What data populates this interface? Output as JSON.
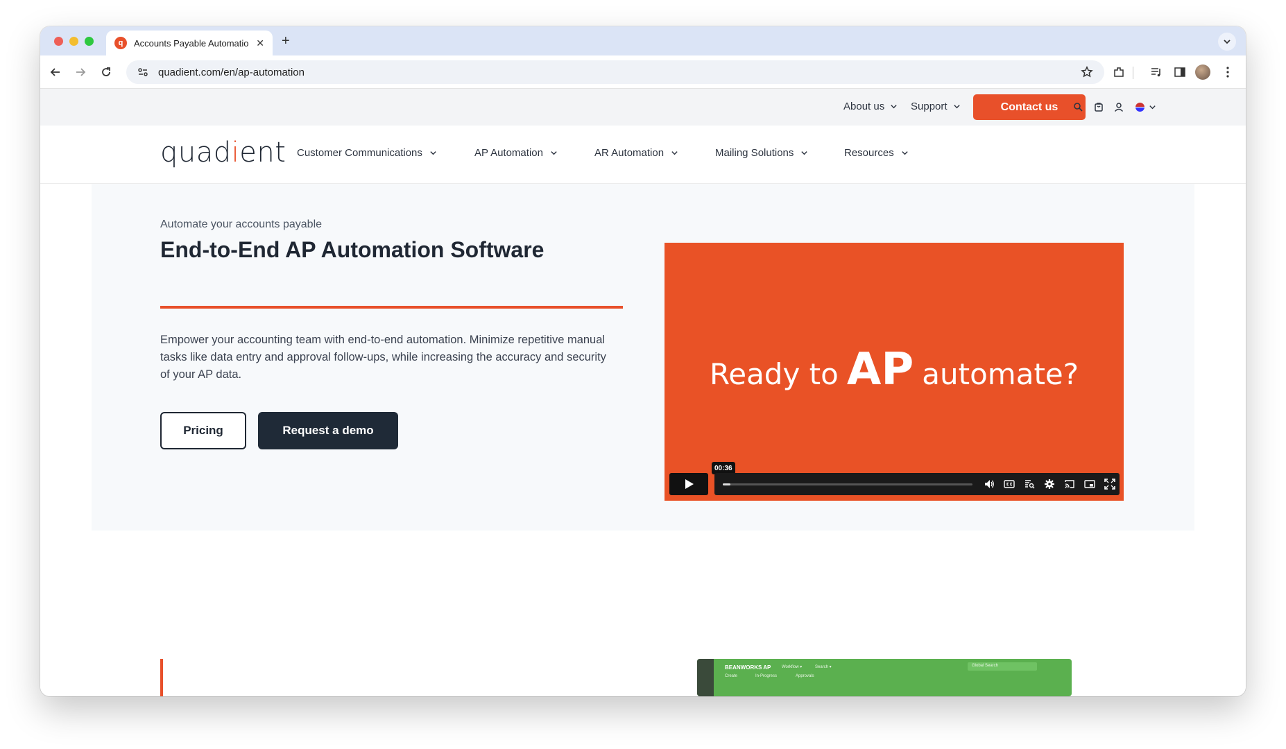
{
  "browser": {
    "tab_title": "Accounts Payable Automation",
    "url": "quadient.com/en/ap-automation"
  },
  "utility_nav": {
    "about": "About us",
    "support": "Support",
    "contact": "Contact us"
  },
  "logo": {
    "text_before": "quad",
    "accent": "i",
    "text_after": "ent"
  },
  "main_nav": [
    {
      "label": "Customer Communications"
    },
    {
      "label": "AP Automation"
    },
    {
      "label": "AR Automation"
    },
    {
      "label": "Mailing Solutions"
    },
    {
      "label": "Resources"
    }
  ],
  "hero": {
    "eyebrow": "Automate your accounts payable",
    "title": "End-to-End AP Automation Software",
    "description": "Empower your accounting team with end-to-end automation. Minimize repetitive manual tasks like data entry and approval follow-ups, while increasing the accuracy and security of your AP data.",
    "pricing_label": "Pricing",
    "demo_label": "Request a demo"
  },
  "video": {
    "title_left": "Ready to",
    "title_ap": "AP",
    "title_right": "automate?",
    "time": "00:36",
    "progress": 0.03
  },
  "app_preview": {
    "brand": "BEANWORKS AP",
    "menu_workflow": "Workflow ▾",
    "menu_search": "Search ▾",
    "sub_create": "Create",
    "sub_inprogress": "In-Progress",
    "sub_approvals": "Approvals",
    "search_placeholder": "Global Search"
  },
  "colors": {
    "accent": "#e8502a",
    "dark": "#1f2a37"
  }
}
